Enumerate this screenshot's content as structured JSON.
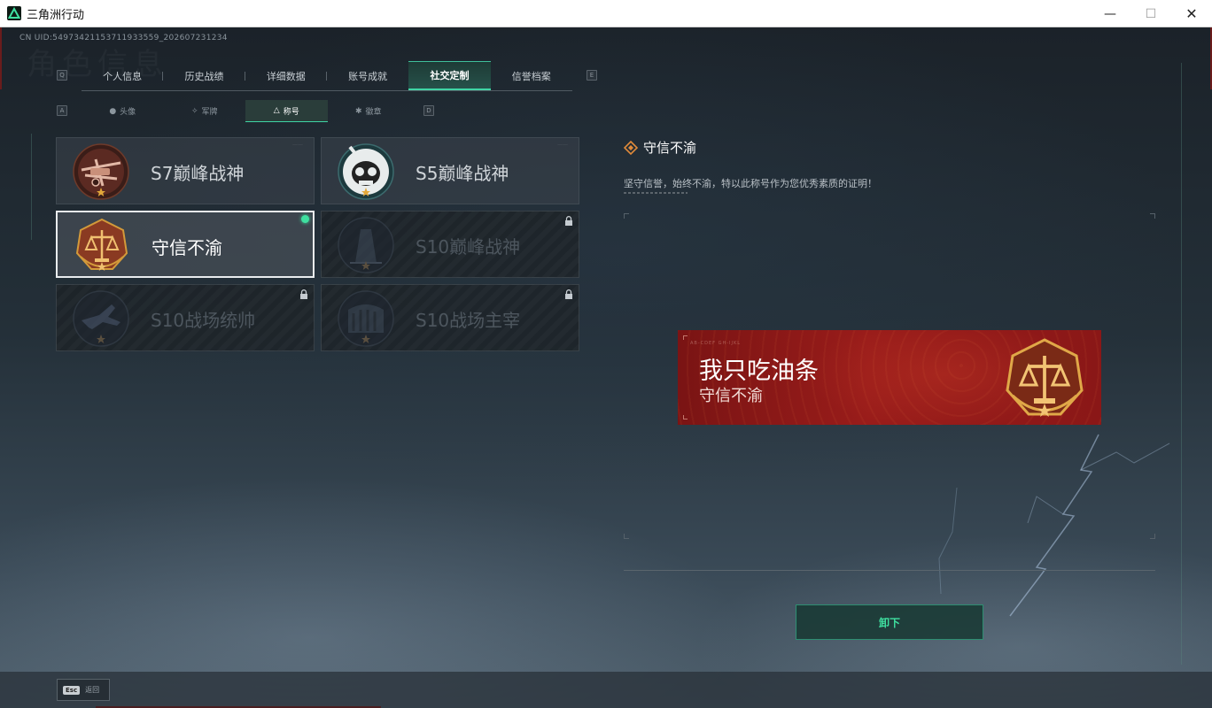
{
  "window": {
    "title": "三角洲行动",
    "minimize": "—",
    "maximize": "☐",
    "close": "✕"
  },
  "uid_text": "CN UID:5497342115371193355​9_202607231234",
  "bg_title": "角色信息",
  "keys": {
    "prev_tab": "Q",
    "next_tab": "E",
    "prev_sub": "A",
    "next_sub": "D"
  },
  "main_tabs": [
    {
      "label": "个人信息",
      "active": false
    },
    {
      "label": "历史战绩",
      "active": false
    },
    {
      "label": "详细数据",
      "active": false
    },
    {
      "label": "账号成就",
      "active": false
    },
    {
      "label": "社交定制",
      "active": true
    },
    {
      "label": "信誉档案",
      "active": false
    }
  ],
  "sub_tabs": [
    {
      "label": "头像",
      "icon": "person-icon",
      "active": false
    },
    {
      "label": "军牌",
      "icon": "wings-icon",
      "active": false
    },
    {
      "label": "称号",
      "icon": "title-icon",
      "active": true
    },
    {
      "label": "徽章",
      "icon": "emblem-icon",
      "active": false
    }
  ],
  "title_cards": [
    {
      "name": "S7巅峰战神",
      "locked": false,
      "selected": false,
      "icon": "crossbow-badge-icon"
    },
    {
      "name": "S5巅峰战神",
      "locked": false,
      "selected": false,
      "icon": "skull-diver-badge-icon"
    },
    {
      "name": "守信不渝",
      "locked": false,
      "selected": true,
      "icon": "scales-badge-icon"
    },
    {
      "name": "S10巅峰战神",
      "locked": true,
      "selected": false,
      "icon": "tower-badge-icon"
    },
    {
      "name": "S10战场统帅",
      "locked": true,
      "selected": false,
      "icon": "aircraft-badge-icon"
    },
    {
      "name": "S10战场主宰",
      "locked": true,
      "selected": false,
      "icon": "colosseum-badge-icon"
    }
  ],
  "detail": {
    "title": "守信不渝",
    "description": "坚守信誉，始终不渝，特以此称号作为您优秀素质的证明！",
    "icon": "diamond-marker-icon"
  },
  "nameplate": {
    "player_name": "我只吃油条",
    "title": "守信不渝",
    "micro_text": "AB-CDEF  GH-IJKL",
    "icon": "scales-badge-icon"
  },
  "unequip_label": "卸下",
  "bottom": {
    "esc_key": "Esc",
    "esc_label": "返回"
  },
  "colors": {
    "accent": "#3fd5a5",
    "selected_dot": "#3fe0a0",
    "nameplate_red": "#991c1a",
    "badge_gold": "#d39a3a",
    "badge_bronze": "#8a3a22"
  }
}
